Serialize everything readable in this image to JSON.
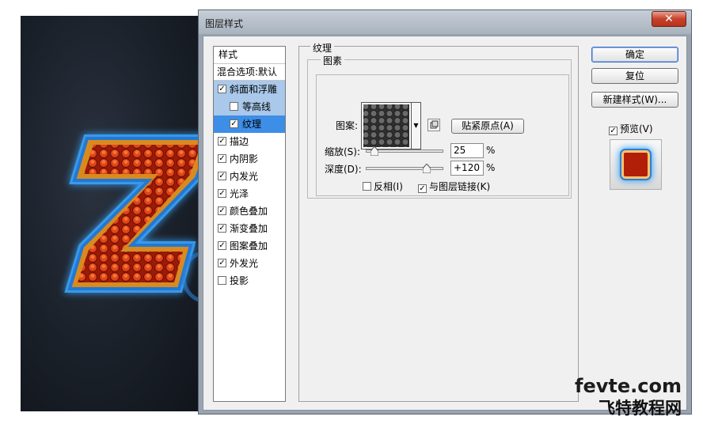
{
  "window": {
    "title": "图层样式",
    "close_label": "✕"
  },
  "style_list": {
    "header": "样式",
    "blend_options": "混合选项:默认",
    "items": [
      {
        "label": "斜面和浮雕",
        "checked": true,
        "sub": false,
        "highlight": "light"
      },
      {
        "label": "等高线",
        "checked": false,
        "sub": true,
        "highlight": "light"
      },
      {
        "label": "纹理",
        "checked": true,
        "sub": true,
        "highlight": "strong"
      },
      {
        "label": "描边",
        "checked": true,
        "sub": false,
        "highlight": "none"
      },
      {
        "label": "内阴影",
        "checked": true,
        "sub": false,
        "highlight": "none"
      },
      {
        "label": "内发光",
        "checked": true,
        "sub": false,
        "highlight": "none"
      },
      {
        "label": "光泽",
        "checked": true,
        "sub": false,
        "highlight": "none"
      },
      {
        "label": "颜色叠加",
        "checked": true,
        "sub": false,
        "highlight": "none"
      },
      {
        "label": "渐变叠加",
        "checked": true,
        "sub": false,
        "highlight": "none"
      },
      {
        "label": "图案叠加",
        "checked": true,
        "sub": false,
        "highlight": "none"
      },
      {
        "label": "外发光",
        "checked": true,
        "sub": false,
        "highlight": "none"
      },
      {
        "label": "投影",
        "checked": false,
        "sub": false,
        "highlight": "none"
      }
    ]
  },
  "texture": {
    "group_title": "纹理",
    "elements_title": "图素",
    "pattern_label": "图案:",
    "snap_origin_label": "贴紧原点(A)",
    "scale": {
      "label": "缩放(S):",
      "value": "25",
      "unit": "%",
      "fraction": 0.1
    },
    "depth": {
      "label": "深度(D):",
      "value": "+120",
      "unit": "%",
      "fraction": 0.78
    },
    "invert": {
      "label": "反相(I)",
      "checked": false
    },
    "link_with_layer": {
      "label": "与图层链接(K)",
      "checked": true
    }
  },
  "buttons": {
    "ok": "确定",
    "reset": "复位",
    "new_style": "新建样式(W)...",
    "preview_label": "预览(V)",
    "preview_checked": true
  },
  "watermark": {
    "en": "fevte.com",
    "cn": "飞特教程网"
  },
  "colors": {
    "accent_selected": "#3d8ee6",
    "accent_light": "#a9c8ea",
    "letter_red": "#b21f08",
    "glow_blue": "#3aa6ff"
  }
}
